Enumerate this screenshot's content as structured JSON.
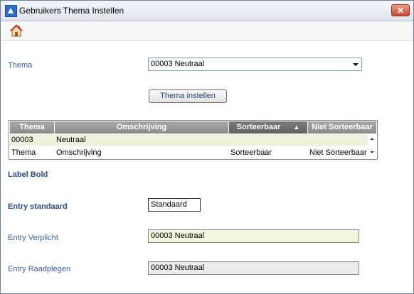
{
  "window": {
    "title": "Gebruikers Thema Instellen",
    "close_label": "✕"
  },
  "toolbar": {
    "home_icon": "home-icon"
  },
  "form": {
    "thema_label": "Thema",
    "thema_value": "00003 Neutraal",
    "apply_button": "Thema instellen",
    "label_bold": "Label Bold",
    "entry_standaard_label": "Entry standaard",
    "entry_standaard_value": "Standaard",
    "entry_verplicht_label": "Entry Verplicht",
    "entry_verplicht_value": "00003 Neutraal",
    "entry_raadplegen_label": "Entry Raadplegen",
    "entry_raadplegen_value": "00003 Neutraal"
  },
  "grid": {
    "columns": [
      "Thema",
      "Omschrijving",
      "Sorteerbaar",
      "Niet Sorteerbaar"
    ],
    "sort_indicator": "▲",
    "rows": [
      [
        "00003",
        "Neutraal",
        "",
        ""
      ],
      [
        "Thema",
        "Omschrijving",
        "Sorteerbaar",
        "Niet Sorteerbaar"
      ]
    ]
  },
  "colors": {
    "verplicht_bg": "#f3f5dc",
    "raadplegen_bg": "#ececec",
    "label_blue": "#3a5f9b"
  }
}
